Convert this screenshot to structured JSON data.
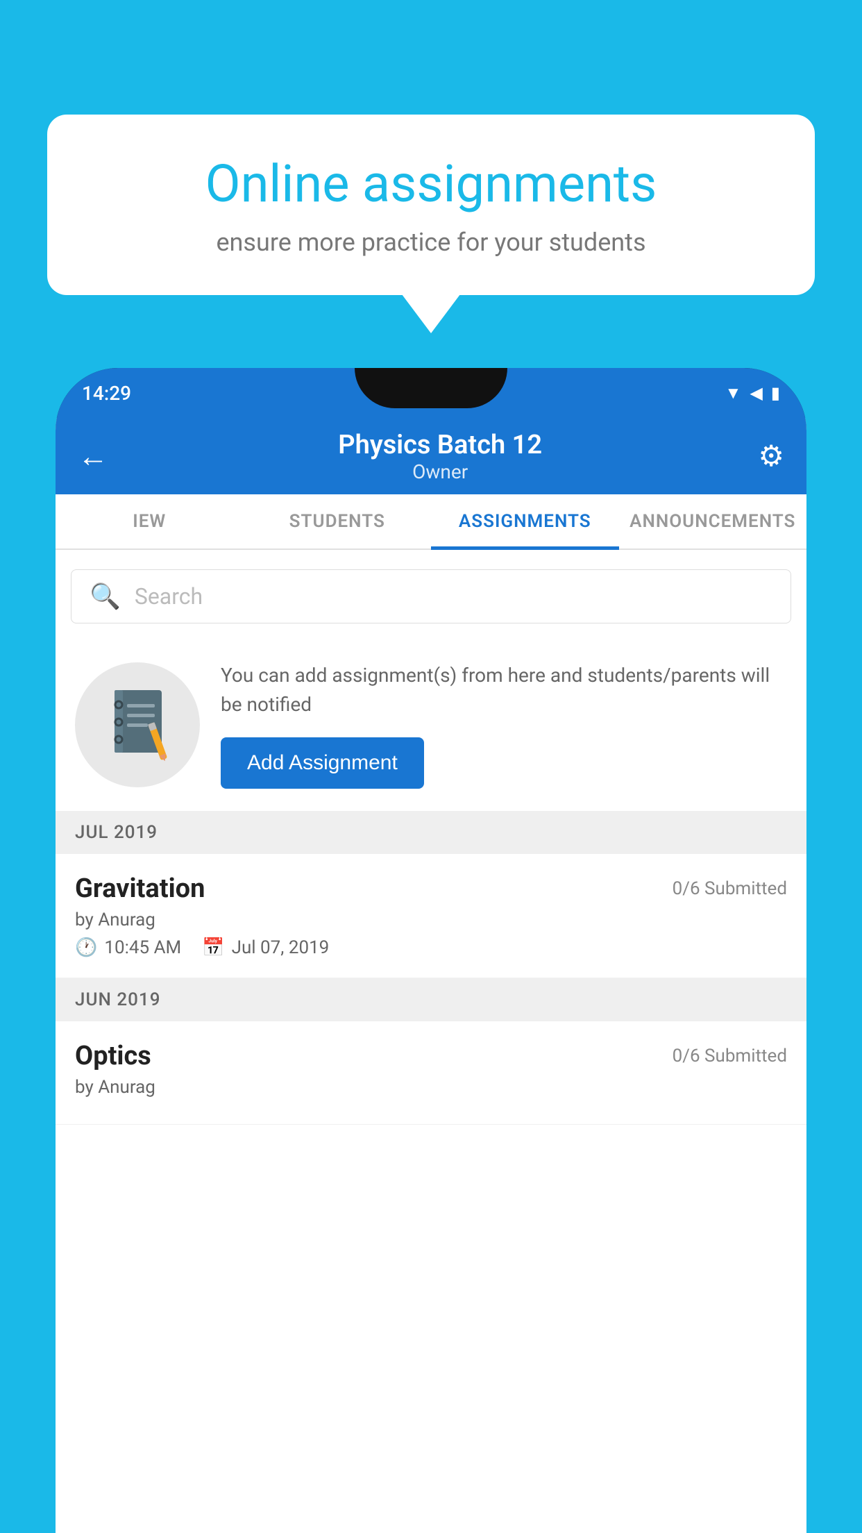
{
  "background_color": "#1ab9e8",
  "promo": {
    "title": "Online assignments",
    "subtitle": "ensure more practice for your students"
  },
  "status_bar": {
    "time": "14:29",
    "icons": [
      "wifi",
      "signal",
      "battery"
    ]
  },
  "toolbar": {
    "title": "Physics Batch 12",
    "subtitle": "Owner",
    "back_label": "←",
    "settings_label": "⚙"
  },
  "tabs": [
    {
      "label": "IEW",
      "active": false
    },
    {
      "label": "STUDENTS",
      "active": false
    },
    {
      "label": "ASSIGNMENTS",
      "active": true
    },
    {
      "label": "ANNOUNCEMENTS",
      "active": false
    }
  ],
  "search": {
    "placeholder": "Search"
  },
  "empty_state": {
    "description": "You can add assignment(s) from here and students/parents will be notified",
    "button_label": "Add Assignment"
  },
  "sections": [
    {
      "month": "JUL 2019",
      "assignments": [
        {
          "name": "Gravitation",
          "submitted": "0/6 Submitted",
          "by": "by Anurag",
          "time": "10:45 AM",
          "date": "Jul 07, 2019"
        }
      ]
    },
    {
      "month": "JUN 2019",
      "assignments": [
        {
          "name": "Optics",
          "submitted": "0/6 Submitted",
          "by": "by Anurag",
          "time": "",
          "date": ""
        }
      ]
    }
  ]
}
